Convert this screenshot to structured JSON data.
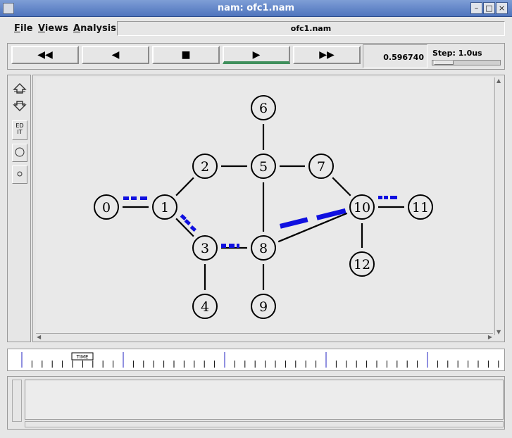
{
  "window": {
    "title": "nam: ofc1.nam"
  },
  "menu": {
    "items": [
      "File",
      "Views",
      "Analysis"
    ],
    "filename": "ofc1.nam"
  },
  "controls": {
    "rewind": "◀◀",
    "back": "◀",
    "stop": "■",
    "play": "▶",
    "fastforward": "▶▶",
    "time": "0.596740",
    "step_label": "Step: 1.0us"
  },
  "toolbox": {
    "edit_label": "ED IT"
  },
  "timeline": {
    "marker_label": "TIME"
  },
  "network": {
    "nodes": [
      {
        "id": "0"
      },
      {
        "id": "1"
      },
      {
        "id": "2"
      },
      {
        "id": "3"
      },
      {
        "id": "4"
      },
      {
        "id": "5"
      },
      {
        "id": "6"
      },
      {
        "id": "7"
      },
      {
        "id": "8"
      },
      {
        "id": "9"
      },
      {
        "id": "10"
      },
      {
        "id": "11"
      },
      {
        "id": "12"
      }
    ],
    "links": [
      [
        "0",
        "1"
      ],
      [
        "1",
        "2"
      ],
      [
        "1",
        "3"
      ],
      [
        "2",
        "5"
      ],
      [
        "5",
        "6"
      ],
      [
        "5",
        "7"
      ],
      [
        "5",
        "8"
      ],
      [
        "3",
        "8"
      ],
      [
        "3",
        "4"
      ],
      [
        "8",
        "9"
      ],
      [
        "7",
        "10"
      ],
      [
        "8",
        "10"
      ],
      [
        "10",
        "11"
      ],
      [
        "10",
        "12"
      ]
    ],
    "packet_color": "#1010e0"
  }
}
